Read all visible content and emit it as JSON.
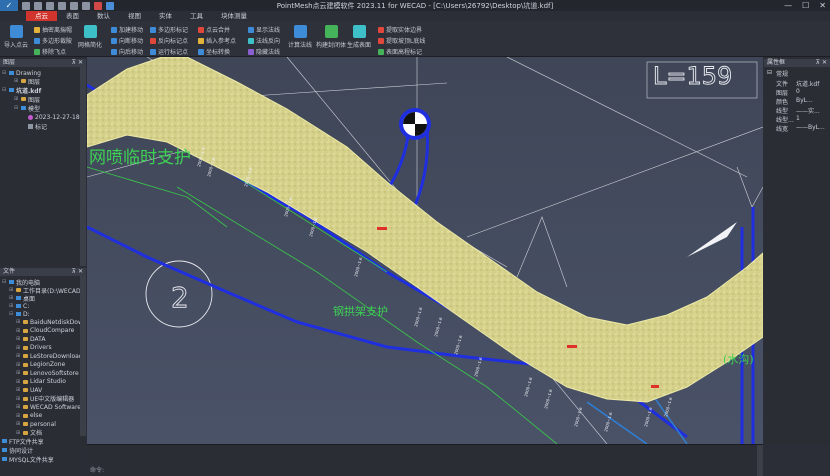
{
  "window": {
    "title": "PointMesh点云建模软件 2023.11 for WECAD - [C:\\Users\\26792\\Desktop\\坑道.kdf]",
    "minimize": "—",
    "maximize": "☐",
    "close": "✕"
  },
  "menu": [
    "点云",
    "表面",
    "数认",
    "视图",
    "实体",
    "工具",
    "块体测量"
  ],
  "ribbon": {
    "import_cloud": "导入点云",
    "col1": [
      "抽密离揣帽",
      "多边形裁陂",
      "移除飞点"
    ],
    "grid_simplify": "网格简化",
    "col2": [
      "加建移动",
      "向断移动",
      "向后移动"
    ],
    "col3": [
      "多边形标记",
      "反向标记点",
      "运行标记点"
    ],
    "col4": [
      "点云合并",
      "插入参考点",
      "坐标转换"
    ],
    "col5": [
      "显示法线",
      "法线反向",
      "隐藏法线"
    ],
    "calc_normal": "计算法线",
    "build_closed": "构建封闭体",
    "gen_surface": "生成表面",
    "col6": [
      "提取实体边界",
      "提取坡顶L底线",
      "表面高程标记"
    ],
    "colors": {
      "red": "#e0483c",
      "blue": "#3e8bd8",
      "green": "#45b35a",
      "yellow": "#e2b23a",
      "purple": "#8a5fd0",
      "cyan": "#3ec0c8"
    }
  },
  "layers_panel": {
    "title": "图层",
    "items": [
      "Drawing",
      "图层",
      "坑道.kdf",
      "图层",
      "模型",
      "2023-12-27-18",
      "标记"
    ]
  },
  "files_panel": {
    "title": "文件",
    "items": [
      "我的电脑",
      "工作目录(D:\\WECAD",
      "桌面",
      "C:",
      "D:",
      "BaiduNetdiskDow",
      "CloudCompare",
      "DATA",
      "Drivers",
      "LeStoreDownload",
      "LegionZone",
      "LenovoSoftstore",
      "Lidar Studio",
      "UAV",
      "UE中文版编辑器",
      "WECAD Software",
      "else",
      "personal",
      "文档"
    ],
    "footer": [
      "FTP文件共享",
      "协同设计",
      "MYSQL文件共享"
    ]
  },
  "properties_panel": {
    "title": "属性框",
    "section": "常规",
    "rows": [
      {
        "k": "文件",
        "v": "坑道.kdf"
      },
      {
        "k": "图层",
        "v": "0"
      },
      {
        "k": "颜色",
        "v": "ByL..."
      },
      {
        "k": "线型",
        "v": "——实..."
      },
      {
        "k": "线型...",
        "v": "1"
      },
      {
        "k": "线宽",
        "v": "——ByL..."
      }
    ]
  },
  "viewport": {
    "label_top": "L=159",
    "label_spray": "网喷临时支护",
    "label_arch": "钢拱架支护",
    "circle_number": "2",
    "label_right": "(水沟)"
  },
  "command": {
    "prompt": "命令:"
  }
}
